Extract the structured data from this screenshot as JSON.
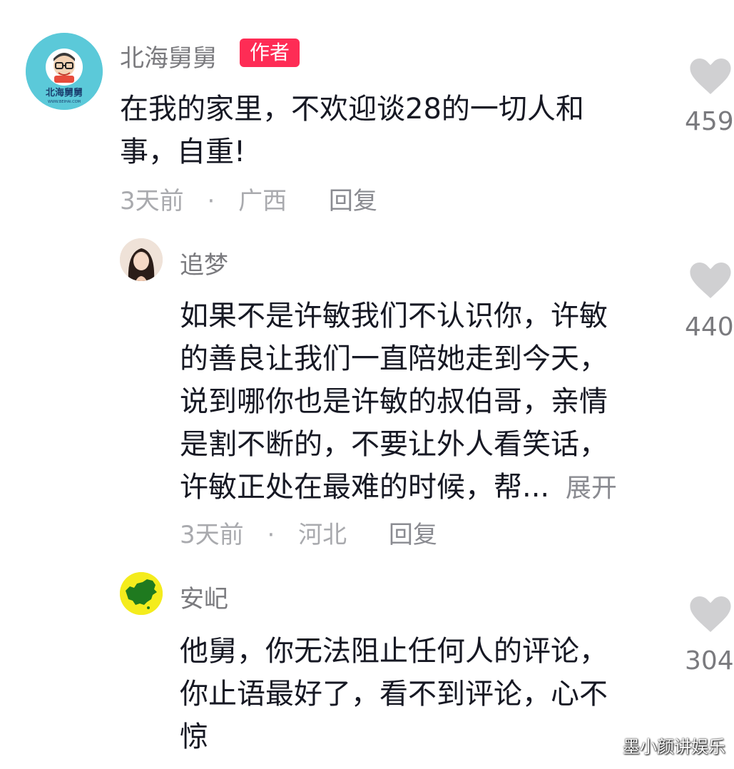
{
  "comments": [
    {
      "username": "北海舅舅",
      "badge": "作者",
      "avatar_icon": "cartoon-man-glasses-icon",
      "avatar_bg": "#5bc9d9",
      "avatar_text": "北海舅舅",
      "lines": [
        "在我的家里，不欢迎谈28的一切人和",
        "事，自重!"
      ],
      "time": "3天前",
      "location": "广西",
      "reply": "回复",
      "likes": "459"
    },
    {
      "username": "追梦",
      "avatar_icon": "woman-portrait-icon",
      "lines": [
        "如果不是许敏我们不认识你，许敏",
        "的善良让我们一直陪她走到今天，",
        "说到哪你也是许敏的叔伯哥，亲情",
        "是割不断的，不要让外人看笑话，",
        "许敏正处在最难的时候，帮..."
      ],
      "expand": "展开",
      "time": "3天前",
      "location": "河北",
      "reply": "回复",
      "likes": "440"
    },
    {
      "username": "安屺",
      "avatar_icon": "china-map-icon",
      "avatar_bg": "#f4ec1d",
      "lines": [
        "他舅，你无法阻止任何人的评论，",
        "你止语最好了，看不到评论，心不",
        "惊"
      ],
      "likes": "304"
    }
  ],
  "separator": "·",
  "watermark": "墨小颜讲娱乐",
  "colors": {
    "badge": "#fe2c55",
    "heart": "#d0d0d2",
    "username": "#7a7a7e",
    "meta": "#a9aaae"
  }
}
